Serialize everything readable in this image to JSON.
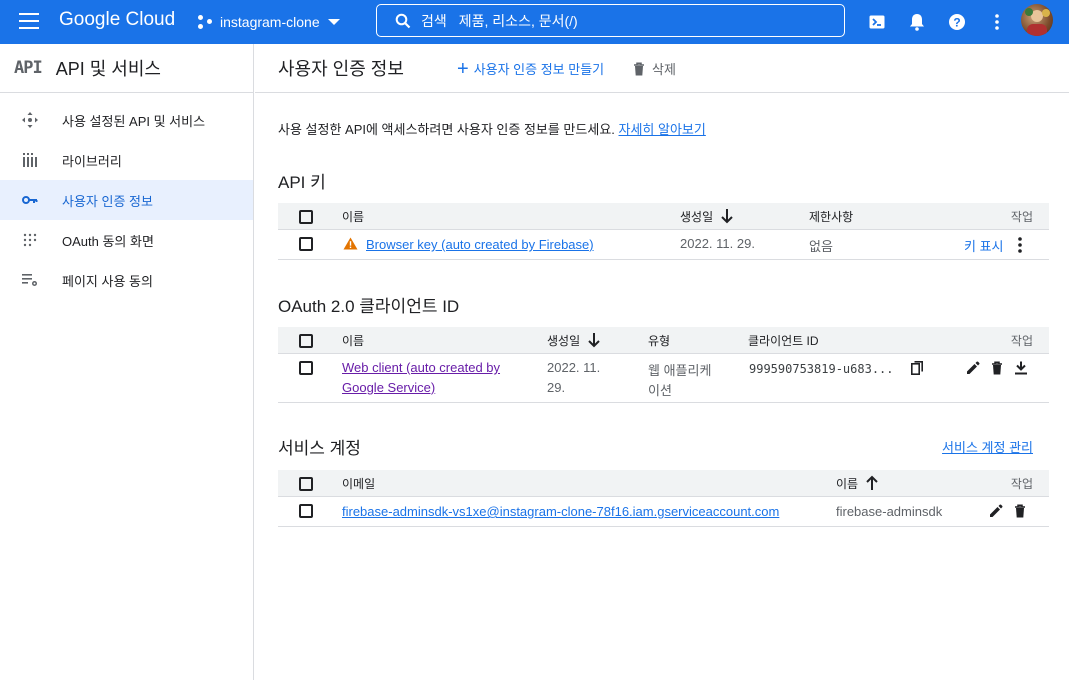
{
  "topbar": {
    "logo": "Google Cloud",
    "project": "instagram-clone",
    "search_label": "검색",
    "search_placeholder": "제품, 리소스, 문서(/)"
  },
  "sidebar": {
    "api_badge": "API",
    "title": "API 및 서비스",
    "items": [
      {
        "label": "사용 설정된 API 및 서비스",
        "icon": "diamond-move-icon"
      },
      {
        "label": "라이브러리",
        "icon": "library-grid-icon"
      },
      {
        "label": "사용자 인증 정보",
        "icon": "key-icon",
        "active": true
      },
      {
        "label": "OAuth 동의 화면",
        "icon": "dots-grid-icon"
      },
      {
        "label": "페이지 사용 동의",
        "icon": "list-settings-icon"
      }
    ]
  },
  "main": {
    "title": "사용자 인증 정보",
    "create_label": "사용자 인증 정보 만들기",
    "delete_label": "삭제",
    "intro_text": "사용 설정한 API에 액세스하려면 사용자 인증 정보를 만드세요.",
    "intro_link": "자세히 알아보기",
    "api_keys": {
      "title": "API 키",
      "headers": {
        "name": "이름",
        "created": "생성일",
        "restrictions": "제한사항",
        "actions": "작업"
      },
      "rows": [
        {
          "name": "Browser key (auto created by Firebase)",
          "created": "2022. 11. 29.",
          "restrictions": "없음",
          "show_key": "키 표시"
        }
      ]
    },
    "oauth": {
      "title": "OAuth 2.0 클라이언트 ID",
      "headers": {
        "name": "이름",
        "created": "생성일",
        "type": "유형",
        "client_id": "클라이언트 ID",
        "actions": "작업"
      },
      "rows": [
        {
          "name_line1": "Web client (auto created by",
          "name_line2": "Google Service)",
          "created_line1": "2022. 11.",
          "created_line2": "29.",
          "type_line1": "웹 애플리케",
          "type_line2": "이션",
          "client_id": "999590753819-u683..."
        }
      ]
    },
    "service_accounts": {
      "title": "서비스 계정",
      "manage_label": "서비스 계정 관리",
      "headers": {
        "email": "이메일",
        "name": "이름",
        "actions": "작업"
      },
      "rows": [
        {
          "email": "firebase-adminsdk-vs1xe@instagram-clone-78f16.iam.gserviceaccount.com",
          "name": "firebase-adminsdk"
        }
      ]
    }
  },
  "colors": {
    "brand": "#1a73e8",
    "active_bg": "#e8f0fe",
    "warning": "#e37400"
  }
}
